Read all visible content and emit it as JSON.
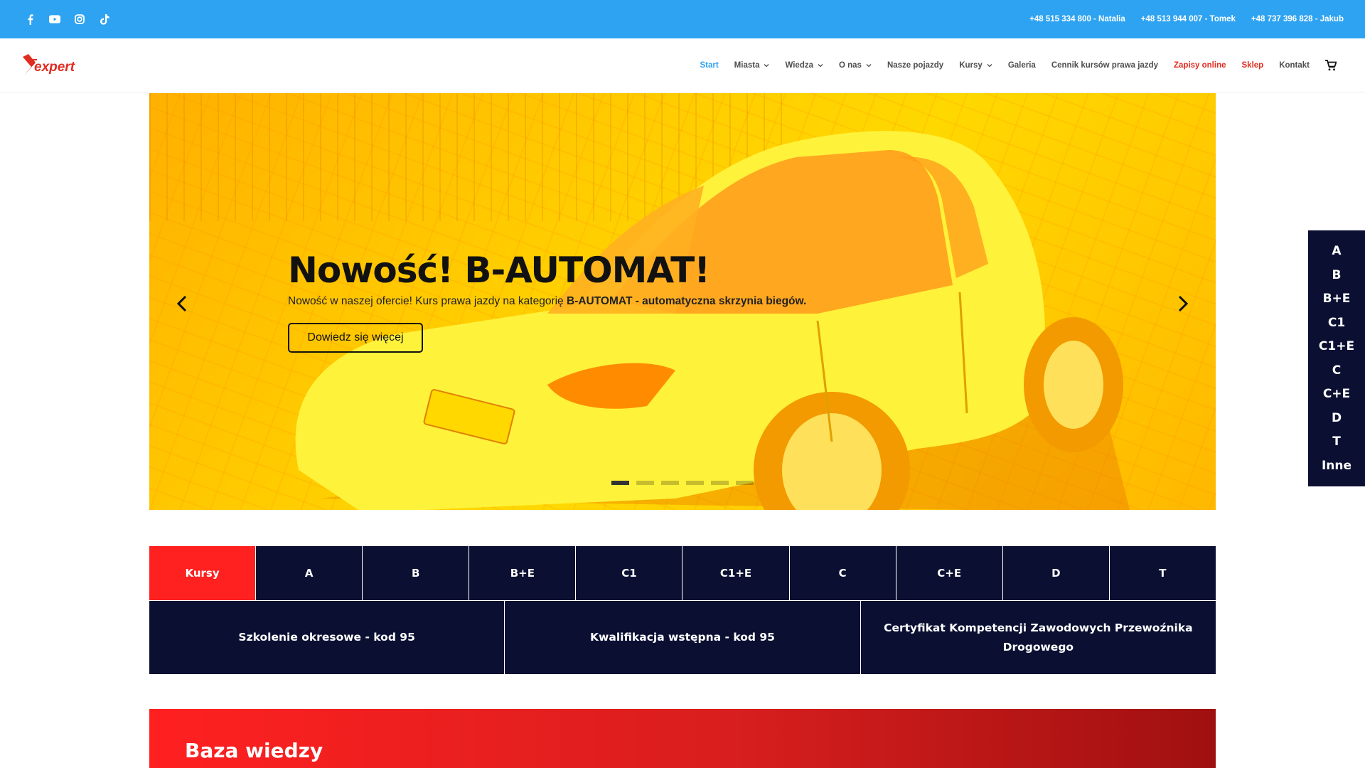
{
  "topbar": {
    "social": [
      "facebook-icon",
      "youtube-icon",
      "instagram-icon",
      "tiktok-icon"
    ],
    "phones": [
      "+48 515 334 800 - Natalia",
      "+48 513 944 007 - Tomek",
      "+48 737 396 828 - Jakub"
    ],
    "bg_color": "#2ea3f2"
  },
  "header": {
    "logo_text": "expert",
    "nav": [
      {
        "label": "Start",
        "dropdown": false,
        "state": "active"
      },
      {
        "label": "Miasta",
        "dropdown": true
      },
      {
        "label": "Wiedza",
        "dropdown": true
      },
      {
        "label": "O nas",
        "dropdown": true
      },
      {
        "label": "Nasze pojazdy",
        "dropdown": false
      },
      {
        "label": "Kursy",
        "dropdown": true
      },
      {
        "label": "Galeria",
        "dropdown": false
      },
      {
        "label": "Cennik kursów prawa jazdy",
        "dropdown": false
      },
      {
        "label": "Zapisy online",
        "dropdown": false,
        "state": "highlight"
      },
      {
        "label": "Sklep",
        "dropdown": false,
        "state": "highlight"
      },
      {
        "label": "Kontakt",
        "dropdown": false
      }
    ],
    "active_color": "#2ea3f2",
    "highlight_color": "#e02b20"
  },
  "hero": {
    "title": "Nowość! B-AUTOMAT!",
    "subtitle_prefix": "Nowość w naszej ofercie! Kurs prawa jazdy na kategorię ",
    "subtitle_bold": "B-AUTOMAT - automatyczna skrzynia biegów.",
    "button_label": "Dowiedz się więcej",
    "slide_count": 6,
    "active_slide": 1
  },
  "side_categories": [
    "A",
    "B",
    "B+E",
    "C1",
    "C1+E",
    "C",
    "C+E",
    "D",
    "T",
    "Inne"
  ],
  "course_tabs": {
    "row1": [
      "Kursy",
      "A",
      "B",
      "B+E",
      "C1",
      "C1+E",
      "C",
      "C+E",
      "D",
      "T"
    ],
    "row2": [
      "Szkolenie okresowe - kod 95",
      "Kwalifikacja wstępna - kod 95",
      "Certyfikat Kompetencji Zawodowych Przewoźnika Drogowego"
    ],
    "navy": "#0b1033",
    "red": "#ff2020"
  },
  "knowledge_base": {
    "title": "Baza wiedzy"
  }
}
